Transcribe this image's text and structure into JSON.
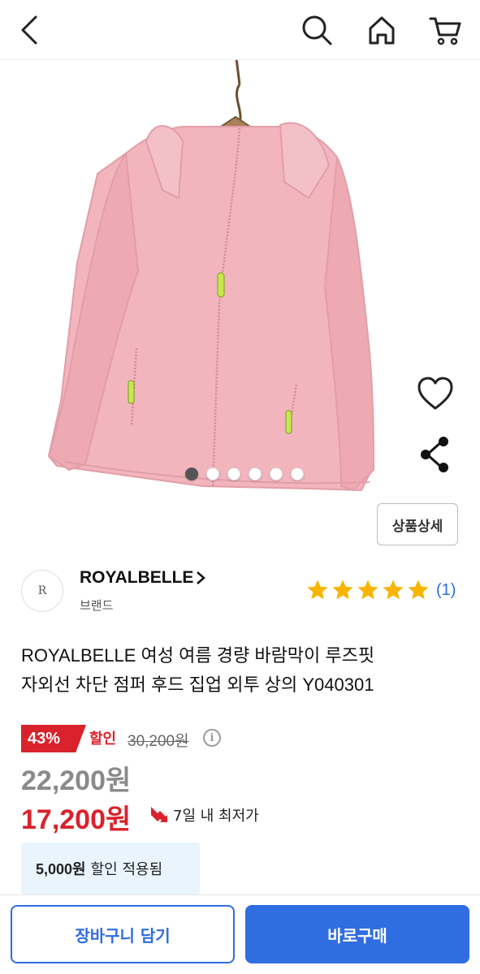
{
  "header": {
    "back_icon": "chevron-left-icon",
    "search_icon": "search-icon",
    "home_icon": "home-icon",
    "cart_icon": "cart-icon"
  },
  "gallery": {
    "image_count": 6,
    "active_index": 0,
    "detail_button": "상품상세",
    "colors": {
      "jacket": "#f2b5bd",
      "zipper": "#c6e84f"
    }
  },
  "brand": {
    "logo_letter": "R",
    "name": "ROYALBELLE",
    "sub": "브랜드",
    "rating_stars": 5,
    "review_count": "(1)"
  },
  "product": {
    "title_line1": "ROYALBELLE 여성 여름 경량 바람막이 루즈핏",
    "title_line2": "자외선 차단 점퍼 후드 집업 외투 상의 Y040301"
  },
  "price": {
    "discount_percent": "43%",
    "discount_label": "할인",
    "original": "30,200원",
    "sale": "22,200원",
    "final": "17,200원",
    "lowest_note": "7일 내 최저가",
    "coupon_amount": "5,000원",
    "coupon_text": "할인 적용됨"
  },
  "actions": {
    "add_to_cart": "장바구니 담기",
    "buy_now": "바로구매"
  },
  "colors": {
    "accent_blue": "#2f6de1",
    "sale_red": "#d9222b",
    "star_yellow": "#f7b500"
  }
}
